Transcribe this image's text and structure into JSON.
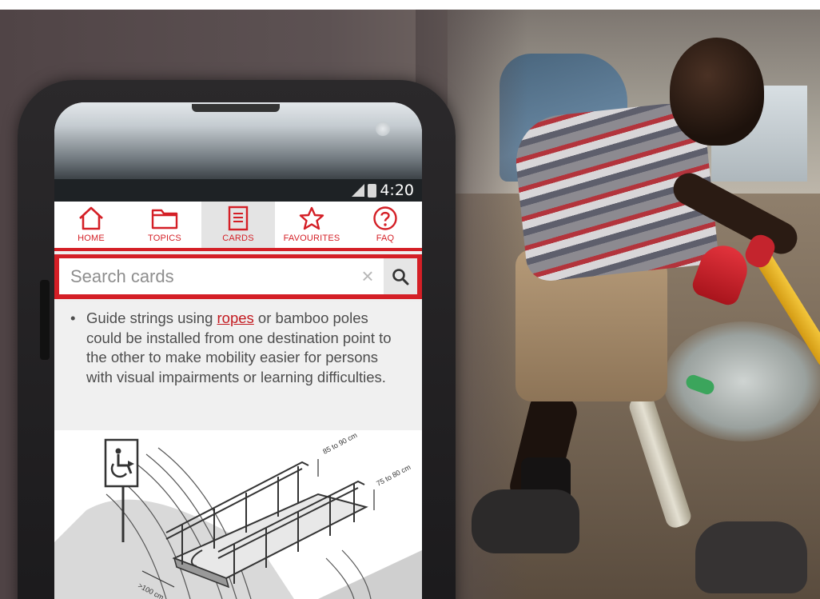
{
  "status": {
    "time": "4:20"
  },
  "nav": [
    {
      "label": "HOME",
      "icon": "home-icon"
    },
    {
      "label": "TOPICS",
      "icon": "folder-icon"
    },
    {
      "label": "CARDS",
      "icon": "cards-icon",
      "active": true
    },
    {
      "label": "FAVOURITES",
      "icon": "star-icon"
    },
    {
      "label": "FAQ",
      "icon": "question-icon"
    }
  ],
  "search": {
    "placeholder": "Search cards",
    "value": ""
  },
  "card": {
    "text_before": "Guide strings using ",
    "link_text": "ropes",
    "text_after": " or bamboo poles could be installed from one destination point to the other to make mobility easier for persons with visual impairments or learning difficulties."
  },
  "figure": {
    "label_top": "85 to 90 cm",
    "label_side": "75 to 80 cm",
    "label_bottom": ">100 cm"
  },
  "colors": {
    "accent": "#d41f26",
    "screen_bg": "#efefef"
  }
}
